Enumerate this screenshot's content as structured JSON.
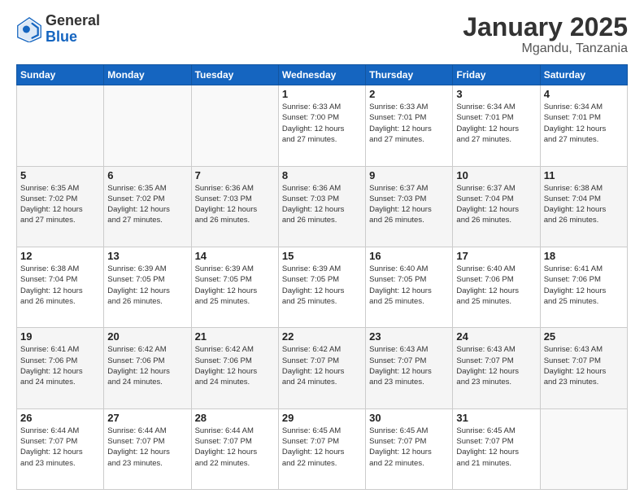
{
  "header": {
    "logo_general": "General",
    "logo_blue": "Blue",
    "title": "January 2025",
    "location": "Mgandu, Tanzania"
  },
  "weekdays": [
    "Sunday",
    "Monday",
    "Tuesday",
    "Wednesday",
    "Thursday",
    "Friday",
    "Saturday"
  ],
  "weeks": [
    [
      {
        "day": "",
        "info": ""
      },
      {
        "day": "",
        "info": ""
      },
      {
        "day": "",
        "info": ""
      },
      {
        "day": "1",
        "info": "Sunrise: 6:33 AM\nSunset: 7:00 PM\nDaylight: 12 hours\nand 27 minutes."
      },
      {
        "day": "2",
        "info": "Sunrise: 6:33 AM\nSunset: 7:01 PM\nDaylight: 12 hours\nand 27 minutes."
      },
      {
        "day": "3",
        "info": "Sunrise: 6:34 AM\nSunset: 7:01 PM\nDaylight: 12 hours\nand 27 minutes."
      },
      {
        "day": "4",
        "info": "Sunrise: 6:34 AM\nSunset: 7:01 PM\nDaylight: 12 hours\nand 27 minutes."
      }
    ],
    [
      {
        "day": "5",
        "info": "Sunrise: 6:35 AM\nSunset: 7:02 PM\nDaylight: 12 hours\nand 27 minutes."
      },
      {
        "day": "6",
        "info": "Sunrise: 6:35 AM\nSunset: 7:02 PM\nDaylight: 12 hours\nand 27 minutes."
      },
      {
        "day": "7",
        "info": "Sunrise: 6:36 AM\nSunset: 7:03 PM\nDaylight: 12 hours\nand 26 minutes."
      },
      {
        "day": "8",
        "info": "Sunrise: 6:36 AM\nSunset: 7:03 PM\nDaylight: 12 hours\nand 26 minutes."
      },
      {
        "day": "9",
        "info": "Sunrise: 6:37 AM\nSunset: 7:03 PM\nDaylight: 12 hours\nand 26 minutes."
      },
      {
        "day": "10",
        "info": "Sunrise: 6:37 AM\nSunset: 7:04 PM\nDaylight: 12 hours\nand 26 minutes."
      },
      {
        "day": "11",
        "info": "Sunrise: 6:38 AM\nSunset: 7:04 PM\nDaylight: 12 hours\nand 26 minutes."
      }
    ],
    [
      {
        "day": "12",
        "info": "Sunrise: 6:38 AM\nSunset: 7:04 PM\nDaylight: 12 hours\nand 26 minutes."
      },
      {
        "day": "13",
        "info": "Sunrise: 6:39 AM\nSunset: 7:05 PM\nDaylight: 12 hours\nand 26 minutes."
      },
      {
        "day": "14",
        "info": "Sunrise: 6:39 AM\nSunset: 7:05 PM\nDaylight: 12 hours\nand 25 minutes."
      },
      {
        "day": "15",
        "info": "Sunrise: 6:39 AM\nSunset: 7:05 PM\nDaylight: 12 hours\nand 25 minutes."
      },
      {
        "day": "16",
        "info": "Sunrise: 6:40 AM\nSunset: 7:05 PM\nDaylight: 12 hours\nand 25 minutes."
      },
      {
        "day": "17",
        "info": "Sunrise: 6:40 AM\nSunset: 7:06 PM\nDaylight: 12 hours\nand 25 minutes."
      },
      {
        "day": "18",
        "info": "Sunrise: 6:41 AM\nSunset: 7:06 PM\nDaylight: 12 hours\nand 25 minutes."
      }
    ],
    [
      {
        "day": "19",
        "info": "Sunrise: 6:41 AM\nSunset: 7:06 PM\nDaylight: 12 hours\nand 24 minutes."
      },
      {
        "day": "20",
        "info": "Sunrise: 6:42 AM\nSunset: 7:06 PM\nDaylight: 12 hours\nand 24 minutes."
      },
      {
        "day": "21",
        "info": "Sunrise: 6:42 AM\nSunset: 7:06 PM\nDaylight: 12 hours\nand 24 minutes."
      },
      {
        "day": "22",
        "info": "Sunrise: 6:42 AM\nSunset: 7:07 PM\nDaylight: 12 hours\nand 24 minutes."
      },
      {
        "day": "23",
        "info": "Sunrise: 6:43 AM\nSunset: 7:07 PM\nDaylight: 12 hours\nand 23 minutes."
      },
      {
        "day": "24",
        "info": "Sunrise: 6:43 AM\nSunset: 7:07 PM\nDaylight: 12 hours\nand 23 minutes."
      },
      {
        "day": "25",
        "info": "Sunrise: 6:43 AM\nSunset: 7:07 PM\nDaylight: 12 hours\nand 23 minutes."
      }
    ],
    [
      {
        "day": "26",
        "info": "Sunrise: 6:44 AM\nSunset: 7:07 PM\nDaylight: 12 hours\nand 23 minutes."
      },
      {
        "day": "27",
        "info": "Sunrise: 6:44 AM\nSunset: 7:07 PM\nDaylight: 12 hours\nand 23 minutes."
      },
      {
        "day": "28",
        "info": "Sunrise: 6:44 AM\nSunset: 7:07 PM\nDaylight: 12 hours\nand 22 minutes."
      },
      {
        "day": "29",
        "info": "Sunrise: 6:45 AM\nSunset: 7:07 PM\nDaylight: 12 hours\nand 22 minutes."
      },
      {
        "day": "30",
        "info": "Sunrise: 6:45 AM\nSunset: 7:07 PM\nDaylight: 12 hours\nand 22 minutes."
      },
      {
        "day": "31",
        "info": "Sunrise: 6:45 AM\nSunset: 7:07 PM\nDaylight: 12 hours\nand 21 minutes."
      },
      {
        "day": "",
        "info": ""
      }
    ]
  ]
}
